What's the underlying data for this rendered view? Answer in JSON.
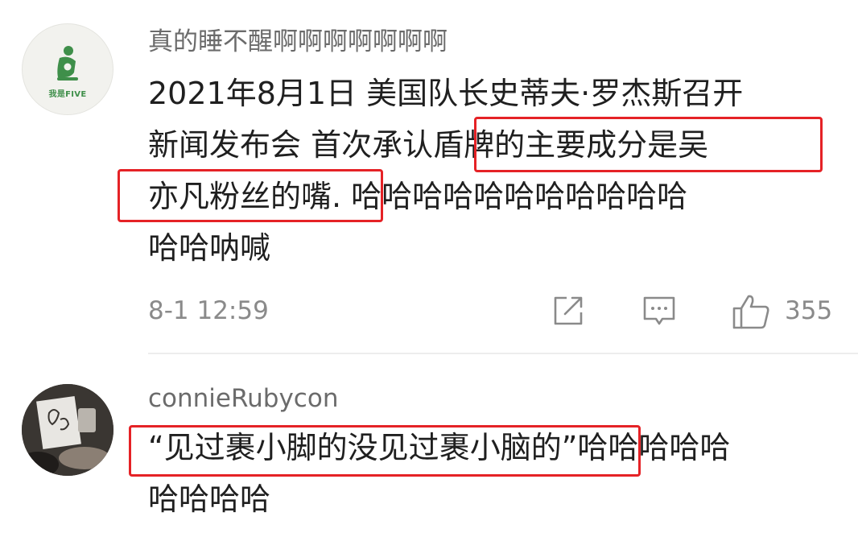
{
  "comments": [
    {
      "username": "真的睡不醒啊啊啊啊啊啊啊",
      "avatar_caption": "我是FIVE",
      "lines": [
        "2021年8月1日 美国队长史蒂夫·罗杰斯召开",
        "新闻发布会 首次承认盾牌的主要成分是吴",
        "亦凡粉丝的嘴. 哈哈哈哈哈哈哈哈哈哈哈",
        "哈哈呐喊"
      ],
      "timestamp": "8-1 12:59",
      "like_count": "355",
      "icons": [
        "share-icon",
        "comment-icon",
        "like-icon"
      ]
    },
    {
      "username": "connieRubycon",
      "lines": [
        "“见过裹小脚的没见过裹小脑的”哈哈哈哈哈",
        "哈哈哈哈"
      ]
    }
  ],
  "colors": {
    "highlight": "#e52226",
    "username": "#6b6b6b",
    "meta": "#8a8a8a",
    "avatar_green": "#3f8f4a"
  }
}
